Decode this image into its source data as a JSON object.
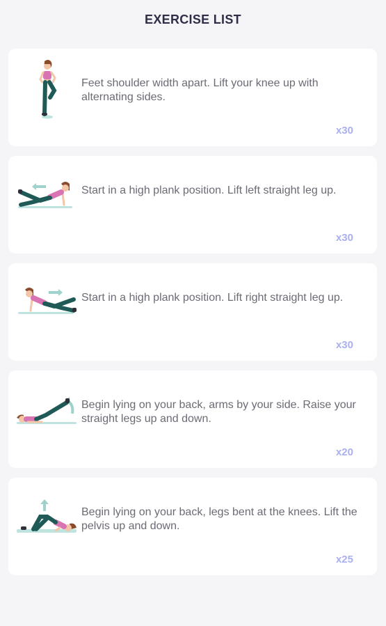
{
  "header": {
    "title": "EXERCISE LIST"
  },
  "exercises": [
    {
      "description": "Feet shoulder width apart. Lift your knee up with alternating sides.",
      "reps": "x30",
      "icon": "high-knees-illustration"
    },
    {
      "description": "Start in a high plank position. Lift left straight leg up.",
      "reps": "x30",
      "icon": "plank-left-leg-illustration"
    },
    {
      "description": "Start in a high plank position. Lift right straight leg up.",
      "reps": "x30",
      "icon": "plank-right-leg-illustration"
    },
    {
      "description": "Begin lying on your back, arms by your side. Raise your straight legs up and down.",
      "reps": "x20",
      "icon": "leg-raise-illustration"
    },
    {
      "description": "Begin lying on your back, legs bent at the knees. Lift the pelvis up and down.",
      "reps": "x25",
      "icon": "glute-bridge-illustration"
    }
  ],
  "colors": {
    "background": "#f5f5f7",
    "card": "#ffffff",
    "reps": "#aab0ee",
    "title": "#2f2e48",
    "outfit_top": "#d974b3",
    "outfit_leggings": "#1f5a57",
    "hair": "#8a4a2c",
    "mat": "#bfe3df"
  }
}
